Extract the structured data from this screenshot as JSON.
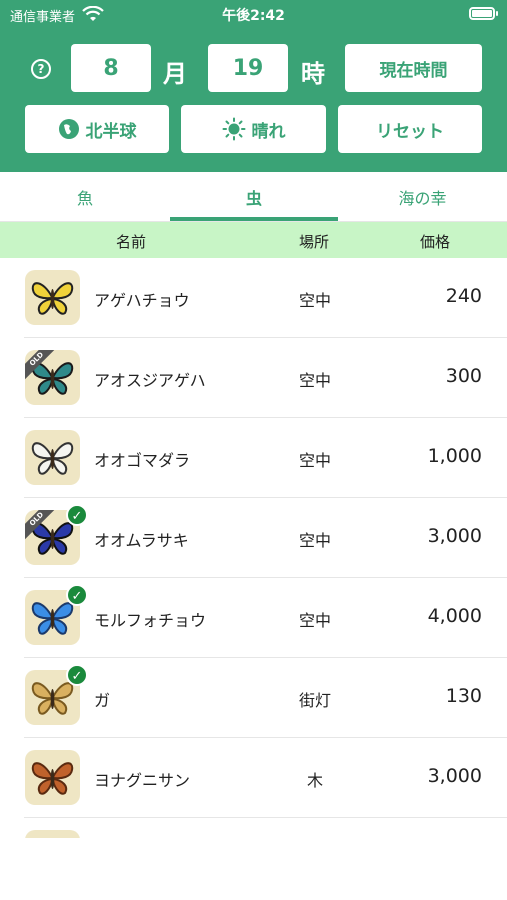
{
  "status": {
    "carrier": "通信事業者",
    "time": "午後2:42"
  },
  "header": {
    "help_icon": "?",
    "month_value": "8",
    "month_unit": "月",
    "hour_value": "19",
    "hour_unit": "時",
    "now_button": "現在時間",
    "hemisphere_button": "北半球",
    "weather_button": "晴れ",
    "reset_button": "リセット"
  },
  "tabs": [
    {
      "label": "魚"
    },
    {
      "label": "虫"
    },
    {
      "label": "海の幸"
    }
  ],
  "active_tab": "虫",
  "columns": {
    "name": "名前",
    "place": "場所",
    "price": "価格"
  },
  "rows": [
    {
      "name": "アゲハチョウ",
      "place": "空中",
      "price": "240",
      "old": false,
      "caught": false,
      "icon": "swallowtail-butterfly",
      "wing_color": "#f0d23a",
      "edge_color": "#222222"
    },
    {
      "name": "アオスジアゲハ",
      "place": "空中",
      "price": "300",
      "old": true,
      "caught": false,
      "icon": "common-bluebottle-butterfly",
      "wing_color": "#2f8a8a",
      "edge_color": "#1a1a1a"
    },
    {
      "name": "オオゴマダラ",
      "place": "空中",
      "price": "1,000",
      "old": false,
      "caught": false,
      "icon": "paper-kite-butterfly",
      "wing_color": "#f5f5f0",
      "edge_color": "#333333"
    },
    {
      "name": "オオムラサキ",
      "place": "空中",
      "price": "3,000",
      "old": true,
      "caught": true,
      "icon": "emperor-butterfly",
      "wing_color": "#2b3aa8",
      "edge_color": "#111111"
    },
    {
      "name": "モルフォチョウ",
      "place": "空中",
      "price": "4,000",
      "old": false,
      "caught": true,
      "icon": "morpho-butterfly",
      "wing_color": "#3b8ee6",
      "edge_color": "#1b3a6b"
    },
    {
      "name": "ガ",
      "place": "街灯",
      "price": "130",
      "old": false,
      "caught": true,
      "icon": "moth",
      "wing_color": "#d9b060",
      "edge_color": "#7a5a20"
    },
    {
      "name": "ヨナグニサン",
      "place": "木",
      "price": "3,000",
      "old": false,
      "caught": false,
      "icon": "atlas-moth",
      "wing_color": "#c0622c",
      "edge_color": "#5a2a10"
    },
    {
      "name": "",
      "place": "",
      "price": "",
      "old": false,
      "caught": false,
      "icon": "partial-row",
      "wing_color": "#efe6c4",
      "edge_color": "#efe6c4"
    }
  ],
  "labels": {
    "old_ribbon": "OLD",
    "check_mark": "✓"
  },
  "colors": {
    "accent": "#3aa376",
    "column_header_bg": "#c8f5c6",
    "check_green": "#1a8a3c"
  }
}
